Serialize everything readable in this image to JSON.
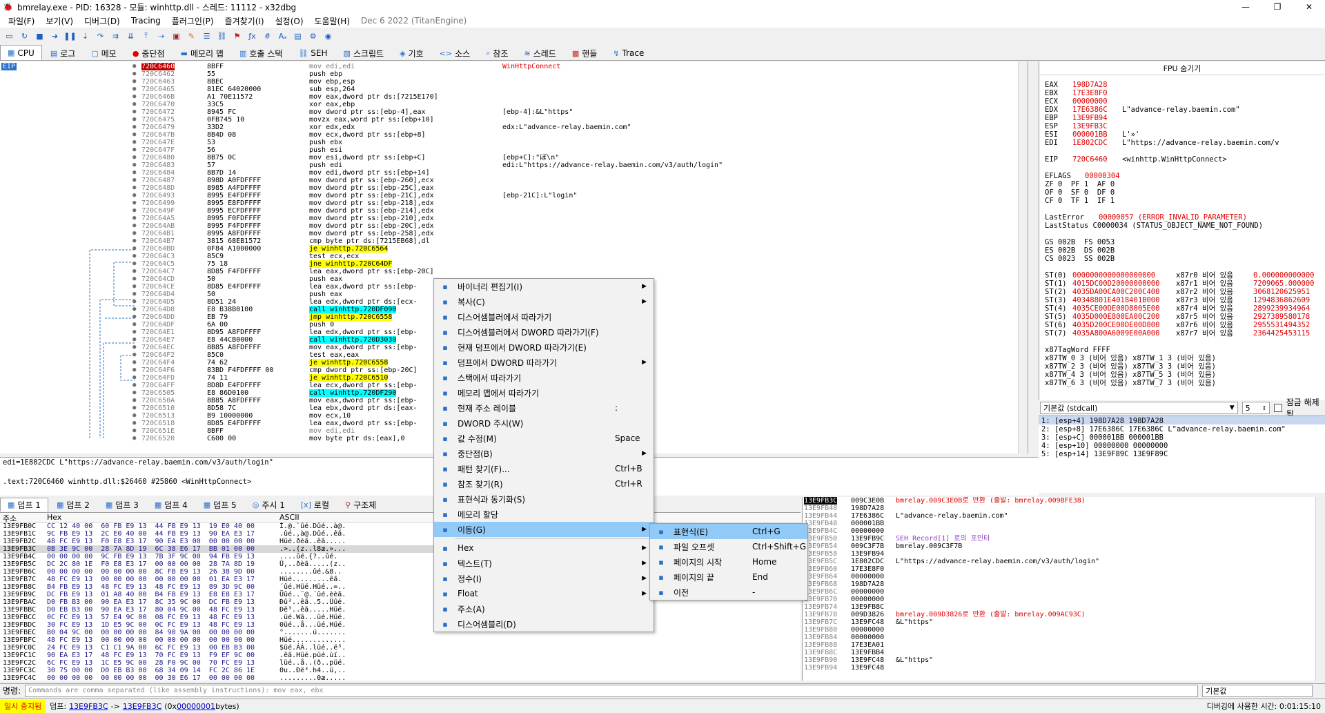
{
  "window": {
    "title": "bmrelay.exe - PID: 16328 - 모듈: winhttp.dll - 스레드: 11112 - x32dbg",
    "minimize": "—",
    "maximize": "❐",
    "close": "✕"
  },
  "menubar": [
    "파일(F)",
    "보기(V)",
    "디버그(D)",
    "Tracing",
    "플러그인(P)",
    "즐겨찾기(I)",
    "설정(O)",
    "도움말(H)"
  ],
  "build_date": "Dec 6 2022 (TitanEngine)",
  "tabs": [
    {
      "label": "CPU",
      "icon": "cpu-icon"
    },
    {
      "label": "로그",
      "icon": "log-icon"
    },
    {
      "label": "메모",
      "icon": "notes-icon"
    },
    {
      "label": "중단점",
      "icon": "breakpoint-icon"
    },
    {
      "label": "메모리 맵",
      "icon": "memory-map-icon"
    },
    {
      "label": "호출 스택",
      "icon": "call-stack-icon"
    },
    {
      "label": "SEH",
      "icon": "seh-icon"
    },
    {
      "label": "스크립트",
      "icon": "script-icon"
    },
    {
      "label": "기호",
      "icon": "symbols-icon"
    },
    {
      "label": "소스",
      "icon": "source-icon"
    },
    {
      "label": "참조",
      "icon": "references-icon"
    },
    {
      "label": "스레드",
      "icon": "threads-icon"
    },
    {
      "label": "핸들",
      "icon": "handles-icon"
    },
    {
      "label": "Trace",
      "icon": "trace-icon"
    }
  ],
  "eip_label": "EIP",
  "disasm": [
    {
      "addr": "720C6460",
      "bytes": "8BFF",
      "asm": "mov edi,edi",
      "comment": "WinHttpConnect",
      "style": "sel"
    },
    {
      "addr": "720C6462",
      "bytes": "55",
      "asm": "push ebp",
      "comment": ""
    },
    {
      "addr": "720C6463",
      "bytes": "8BEC",
      "asm": "mov ebp,esp",
      "comment": ""
    },
    {
      "addr": "720C6465",
      "bytes": "81EC 64020000",
      "asm": "sub esp,264",
      "comment": ""
    },
    {
      "addr": "720C646B",
      "bytes": "A1 70E11572",
      "asm": "mov eax,dword ptr ds:[7215E170]",
      "comment": ""
    },
    {
      "addr": "720C6470",
      "bytes": "33C5",
      "asm": "xor eax,ebp",
      "comment": ""
    },
    {
      "addr": "720C6472",
      "bytes": "8945 FC",
      "asm": "mov dword ptr ss:[ebp-4],eax",
      "comment": "[ebp-4]:&L\"https\""
    },
    {
      "addr": "720C6475",
      "bytes": "0FB745 10",
      "asm": "movzx eax,word ptr ss:[ebp+10]",
      "comment": ""
    },
    {
      "addr": "720C6479",
      "bytes": "33D2",
      "asm": "xor edx,edx",
      "comment": "edx:L\"advance-relay.baemin.com\""
    },
    {
      "addr": "720C647B",
      "bytes": "8B4D 08",
      "asm": "mov ecx,dword ptr ss:[ebp+8]",
      "comment": ""
    },
    {
      "addr": "720C647E",
      "bytes": "53",
      "asm": "push ebx",
      "comment": ""
    },
    {
      "addr": "720C647F",
      "bytes": "56",
      "asm": "push esi",
      "comment": ""
    },
    {
      "addr": "720C6480",
      "bytes": "8B75 0C",
      "asm": "mov esi,dword ptr ss:[ebp+C]",
      "comment": "[ebp+C]:\"ぼ\\n\""
    },
    {
      "addr": "720C6483",
      "bytes": "57",
      "asm": "push edi",
      "comment": "edi:L\"https://advance-relay.baemin.com/v3/auth/login\""
    },
    {
      "addr": "720C6484",
      "bytes": "8B7D 14",
      "asm": "mov edi,dword ptr ss:[ebp+14]",
      "comment": ""
    },
    {
      "addr": "720C6487",
      "bytes": "898D A0FDFFFF",
      "asm": "mov dword ptr ss:[ebp-260],ecx",
      "comment": ""
    },
    {
      "addr": "720C648D",
      "bytes": "8985 A4FDFFFF",
      "asm": "mov dword ptr ss:[ebp-25C],eax",
      "comment": ""
    },
    {
      "addr": "720C6493",
      "bytes": "8995 E4FDFFFF",
      "asm": "mov dword ptr ss:[ebp-21C],edx",
      "comment": "[ebp-21C]:L\"login\""
    },
    {
      "addr": "720C6499",
      "bytes": "8995 E8FDFFFF",
      "asm": "mov dword ptr ss:[ebp-218],edx",
      "comment": ""
    },
    {
      "addr": "720C649F",
      "bytes": "8995 ECFDFFFF",
      "asm": "mov dword ptr ss:[ebp-214],edx",
      "comment": ""
    },
    {
      "addr": "720C64A5",
      "bytes": "8995 F0FDFFFF",
      "asm": "mov dword ptr ss:[ebp-210],edx",
      "comment": ""
    },
    {
      "addr": "720C64AB",
      "bytes": "8995 F4FDFFFF",
      "asm": "mov dword ptr ss:[ebp-20C],edx",
      "comment": ""
    },
    {
      "addr": "720C64B1",
      "bytes": "8995 A8FDFFFF",
      "asm": "mov dword ptr ss:[ebp-258],edx",
      "comment": ""
    },
    {
      "addr": "720C64B7",
      "bytes": "3815 68EB1572",
      "asm": "cmp byte ptr ds:[7215EB68],dl",
      "comment": ""
    },
    {
      "addr": "720C64BD",
      "bytes": "0F84 A1000000",
      "asm": "je winhttp.720C6564",
      "comment": "",
      "style": "y"
    },
    {
      "addr": "720C64C3",
      "bytes": "85C9",
      "asm": "test ecx,ecx",
      "comment": ""
    },
    {
      "addr": "720C64C5",
      "bytes": "75 18",
      "asm": "jne winhttp.720C64DF",
      "comment": "",
      "style": "y"
    },
    {
      "addr": "720C64C7",
      "bytes": "8D85 F4FDFFFF",
      "asm": "lea eax,dword ptr ss:[ebp-20C]",
      "comment": ""
    },
    {
      "addr": "720C64CD",
      "bytes": "50",
      "asm": "push eax",
      "comment": ""
    },
    {
      "addr": "720C64CE",
      "bytes": "8D85 E4FDFFFF",
      "asm": "lea eax,dword ptr ss:[ebp-",
      "comment": ""
    },
    {
      "addr": "720C64D4",
      "bytes": "50",
      "asm": "push eax",
      "comment": ""
    },
    {
      "addr": "720C64D5",
      "bytes": "8D51 24",
      "asm": "lea edx,dword ptr ds:[ecx-",
      "comment": ""
    },
    {
      "addr": "720C64D8",
      "bytes": "E8 B38B0100",
      "asm": "call winhttp.720DF090",
      "comment": "",
      "style": "c"
    },
    {
      "addr": "720C64DD",
      "bytes": "EB 79",
      "asm": "jmp winhttp.720C6558",
      "comment": "",
      "style": "y"
    },
    {
      "addr": "720C64DF",
      "bytes": "6A 00",
      "asm": "push 0",
      "comment": ""
    },
    {
      "addr": "720C64E1",
      "bytes": "8D95 A8FDFFFF",
      "asm": "lea edx,dword ptr ss:[ebp-",
      "comment": ""
    },
    {
      "addr": "720C64E7",
      "bytes": "E8 44CB0000",
      "asm": "call winhttp.720D3030",
      "comment": "",
      "style": "c"
    },
    {
      "addr": "720C64EC",
      "bytes": "8B85 A8FDFFFF",
      "asm": "mov eax,dword ptr ss:[ebp-",
      "comment": ""
    },
    {
      "addr": "720C64F2",
      "bytes": "85C0",
      "asm": "test eax,eax",
      "comment": ""
    },
    {
      "addr": "720C64F4",
      "bytes": "74 62",
      "asm": "je winhttp.720C6558",
      "comment": "",
      "style": "y"
    },
    {
      "addr": "720C64F6",
      "bytes": "83BD F4FDFFFF 00",
      "asm": "cmp dword ptr ss:[ebp-20C]",
      "comment": ""
    },
    {
      "addr": "720C64FD",
      "bytes": "74 11",
      "asm": "je winhttp.720C6510",
      "comment": "",
      "style": "y"
    },
    {
      "addr": "720C64FF",
      "bytes": "8D8D E4FDFFFF",
      "asm": "lea ecx,dword ptr ss:[ebp-",
      "comment": ""
    },
    {
      "addr": "720C6505",
      "bytes": "E8 86D0100",
      "asm": "call winhttp.720DF290",
      "comment": "",
      "style": "c"
    },
    {
      "addr": "720C650A",
      "bytes": "8B85 A8FDFFFF",
      "asm": "mov eax,dword ptr ss:[ebp-",
      "comment": ""
    },
    {
      "addr": "720C6510",
      "bytes": "8D58 7C",
      "asm": "lea ebx,dword ptr ds:[eax-",
      "comment": ""
    },
    {
      "addr": "720C6513",
      "bytes": "B9 10000000",
      "asm": "mov ecx,10",
      "comment": ""
    },
    {
      "addr": "720C6518",
      "bytes": "8D85 E4FDFFFF",
      "asm": "lea eax,dword ptr ss:[ebp-",
      "comment": ""
    },
    {
      "addr": "720C651E",
      "bytes": "8BFF",
      "asm": "mov edi,edi",
      "comment": "",
      "style": "g"
    },
    {
      "addr": "720C6520",
      "bytes": "C600 00",
      "asm": "mov byte ptr ds:[eax],0",
      "comment": ""
    }
  ],
  "info_lines": [
    "edi=1E802CDC L\"https://advance-relay.baemin.com/v3/auth/login\"",
    "",
    ".text:720C6460 winhttp.dll:$26460 #25860 <WinHttpConnect>"
  ],
  "fpu": {
    "header": "FPU 숨기기",
    "regs": [
      {
        "name": "EAX",
        "val": "198D7A28",
        "note": ""
      },
      {
        "name": "EBX",
        "val": "17E3E8F0",
        "note": ""
      },
      {
        "name": "ECX",
        "val": "00000000",
        "note": ""
      },
      {
        "name": "EDX",
        "val": "17E6386C",
        "note": "L\"advance-relay.baemin.com\""
      },
      {
        "name": "EBP",
        "val": "13E9FB94",
        "note": ""
      },
      {
        "name": "ESP",
        "val": "13E9FB3C",
        "note": ""
      },
      {
        "name": "ESI",
        "val": "000001BB",
        "note": "L'»'"
      },
      {
        "name": "EDI",
        "val": "1E802CDC",
        "note": "L\"https://advance-relay.baemin.com/v"
      }
    ],
    "eip": {
      "name": "EIP",
      "val": "720C6460",
      "note": "<winhttp.WinHttpConnect>"
    },
    "eflags": {
      "name": "EFLAGS",
      "val": "00000304"
    },
    "flags": [
      "ZF 0  PF 1  AF 0",
      "OF 0  SF 0  DF 0",
      "CF 0  TF 1  IF 1"
    ],
    "last_error": {
      "label": "LastError",
      "val": "00000057 (ERROR_INVALID_PARAMETER)"
    },
    "last_status": "LastStatus C0000034 (STATUS_OBJECT_NAME_NOT_FOUND)",
    "segs": [
      "GS 002B  FS 0053",
      "ES 002B  DS 002B",
      "CS 0023  SS 002B"
    ],
    "st": [
      {
        "name": "ST(0)",
        "val": "0000000000000000000",
        "tag": "x87r0 비어 있음",
        "num": "0.000000000000"
      },
      {
        "name": "ST(1)",
        "val": "4015DC00D20000000000",
        "tag": "x87r1 비어 있음",
        "num": "7209065.000000"
      },
      {
        "name": "ST(2)",
        "val": "4035DA00CA00C200C400",
        "tag": "x87r2 비어 있음",
        "num": "3068120625951"
      },
      {
        "name": "ST(3)",
        "val": "40348801E4018401B000",
        "tag": "x87r3 비어 있음",
        "num": "1294836862609"
      },
      {
        "name": "ST(4)",
        "val": "4035CE00DE00D8005E00",
        "tag": "x87r4 비어 있음",
        "num": "2899239934964"
      },
      {
        "name": "ST(5)",
        "val": "4035D000E800EA00C200",
        "tag": "x87r5 비어 있음",
        "num": "2927389580178"
      },
      {
        "name": "ST(6)",
        "val": "4035D200CE00DE00D800",
        "tag": "x87r6 비어 있음",
        "num": "2955531494352"
      },
      {
        "name": "ST(7)",
        "val": "4035A800A6009E00A000",
        "tag": "x87r7 비어 있음",
        "num": "2364425453115"
      }
    ],
    "tagword": "x87TagWord FFFF",
    "tags": [
      "x87TW_0 3 (비어 있음) x87TW_1 3 (비어 있음)",
      "x87TW_2 3 (비어 있음) x87TW_3 3 (비어 있음)",
      "x87TW_4 3 (비어 있음) x87TW_5 3 (비어 있음)",
      "x87TW_6 3 (비어 있음) x87TW_7 3 (비어 있음)"
    ]
  },
  "callconv": {
    "value": "기본값 (stdcall)",
    "count": "5",
    "lock_label": "잠금 해제됨"
  },
  "stack_args": [
    "1: [esp+4] 198D7A28 198D7A28",
    "2: [esp+8] 17E6386C 17E6386C L\"advance-relay.baemin.com\"",
    "3: [esp+C] 000001BB 000001BB",
    "4: [esp+10] 00000000 00000000",
    "5: [esp+14] 13E9F89C 13E9F89C"
  ],
  "dump_tabs": [
    "덤프 1",
    "덤프 2",
    "덤프 3",
    "덤프 4",
    "덤프 5",
    "주시 1",
    "로컬",
    "구조체"
  ],
  "dump_headers": {
    "addr": "주소",
    "hex": "Hex",
    "ascii": "ASCII"
  },
  "dump": [
    {
      "a": "13E9FB0C",
      "h": "CC 12 40 00  60 FB E9 13  44 FB E9 13  19 E0 40 00",
      "s": "Ì.@.`ûé.Dûé..à@."
    },
    {
      "a": "13E9FB1C",
      "h": "9C FB E9 13  2C E0 40 00  44 FB E9 13  90 EA E3 17",
      "s": ".ûé.,à@.Dûé..êã."
    },
    {
      "a": "13E9FB2C",
      "h": "48 FC E9 13  F0 E8 E3 17  90 EA E3 00  00 00 00 00",
      "s": "Hüé.ðèã..êã....."
    },
    {
      "a": "13E9FB3C",
      "h": "0B 3E 9C 00  28 7A 8D 19  6C 38 E6 17  BB 01 00 00",
      "s": ".>..(z..l8æ.»..."
    },
    {
      "a": "13E9FB4C",
      "h": "00 00 00 00  9C FB E9 13  7B 3F 9C 00  94 FB E9 13",
      "s": "....ûé.{?..ûé."
    },
    {
      "a": "13E9FB5C",
      "h": "DC 2C 80 1E  F0 E8 E3 17  00 00 00 00  28 7A 8D 19",
      "s": "Ü,..ðèã.....(z.."
    },
    {
      "a": "13E9FB6C",
      "h": "00 00 00 00  00 00 00 00  8C FB E9 13  26 38 9D 00",
      "s": "........ûé.&8.."
    },
    {
      "a": "13E9FB7C",
      "h": "48 FC E9 13  00 00 00 00  00 00 00 00  01 EA E3 17",
      "s": "Hüé.........êã."
    },
    {
      "a": "13E9FB8C",
      "h": "B4 FB E9 13  48 FC E9 13  48 FC E9 13  89 3D 9C 00",
      "s": "´ûé.Hüé.Hüé..=.."
    },
    {
      "a": "13E9FB9C",
      "h": "DC FB E9 13  01 A8 40 00  B4 FB E9 13  E8 E8 E3 17",
      "s": "Üûé..¨@.´ûé.èèã."
    },
    {
      "a": "13E9FBAC",
      "h": "D0 FB B3 00  90 EA E3 17  8C 35 9C 00  DC FB E9 13",
      "s": "Ðû³..êã..5..Üûé."
    },
    {
      "a": "13E9FBBC",
      "h": "D0 EB B3 00  90 EA E3 17  80 04 9C 00  48 FC E9 13",
      "s": "Ðë³..êã.....Hüé."
    },
    {
      "a": "13E9FBCC",
      "h": "0C FC E9 13  57 E4 9C 00  08 FC E9 13  48 FC E9 13",
      "s": ".üé.Wä...üé.Hüé."
    },
    {
      "a": "13E9FBDC",
      "h": "30 FC E9 13  1D E5 9C 00  0C FC E9 13  48 FC E9 13",
      "s": "0üé..å...üé.Hüé."
    },
    {
      "a": "13E9FBEC",
      "h": "B0 04 9C 00  00 00 00 00  84 90 9A 00  00 00 00 00",
      "s": "°.......ú......."
    },
    {
      "a": "13E9FBFC",
      "h": "48 FC E9 13  00 00 00 00  00 00 00 00  00 00 00 00",
      "s": "Hüé............."
    },
    {
      "a": "13E9FC0C",
      "h": "24 FC E9 13  C1 C1 9A 00  6C FC E9 13  00 EB B3 00",
      "s": "$üé.ÁÁ..lüé..ë³."
    },
    {
      "a": "13E9FC1C",
      "h": "90 EA E3 17  48 FC E9 13  70 FC E9 13  F9 EF 9C 00",
      "s": ".êã.Hüé.püé.ùï.."
    },
    {
      "a": "13E9FC2C",
      "h": "6C FC E9 13  1C E5 9C 00  28 F0 9C 00  70 FC E9 13",
      "s": "lüé..å..(ð..püé."
    },
    {
      "a": "13E9FC3C",
      "h": "30 75 00 00  D0 EB B3 00  68 34 09 14  FC 2C 86 1E",
      "s": "0u..Ðë³.h4..ü,.."
    },
    {
      "a": "13E9FC4C",
      "h": "00 00 00 00  00 00 00 00  00 30 E6 17  00 00 00 00",
      "s": ".........0æ....."
    }
  ],
  "stack": [
    {
      "a": "13E9FB3C",
      "v": "009C3E0B",
      "c": "bmrelay.009C3E0B로 반환 (출발: bmrelay.009BFE38)",
      "cls": "red",
      "top": true
    },
    {
      "a": "13E9FB40",
      "v": "198D7A28",
      "c": ""
    },
    {
      "a": "13E9FB44",
      "v": "17E6386C",
      "c": "L\"advance-relay.baemin.com\""
    },
    {
      "a": "13E9FB48",
      "v": "000001BB",
      "c": ""
    },
    {
      "a": "13E9FB4C",
      "v": "00000000",
      "c": ""
    },
    {
      "a": "13E9FB50",
      "v": "13E9FB9C",
      "c": "SEH_Record[1] 로의 포인터",
      "cls": "purple"
    },
    {
      "a": "13E9FB54",
      "v": "009C3F7B",
      "c": "bmrelay.009C3F7B"
    },
    {
      "a": "13E9FB58",
      "v": "13E9FB94",
      "c": ""
    },
    {
      "a": "13E9FB5C",
      "v": "1E802CDC",
      "c": "L\"https://advance-relay.baemin.com/v3/auth/login\""
    },
    {
      "a": "13E9FB60",
      "v": "17E3E8F0",
      "c": ""
    },
    {
      "a": "13E9FB64",
      "v": "00000000",
      "c": ""
    },
    {
      "a": "13E9FB68",
      "v": "198D7A28",
      "c": ""
    },
    {
      "a": "13E9FB6C",
      "v": "00000000",
      "c": ""
    },
    {
      "a": "13E9FB70",
      "v": "00000000",
      "c": ""
    },
    {
      "a": "13E9FB74",
      "v": "13E9FB8C",
      "c": ""
    },
    {
      "a": "13E9FB78",
      "v": "009D3826",
      "c": "bmrelay.009D3826로 반환 (출발: bmrelay.009AC93C)",
      "cls": "red"
    },
    {
      "a": "13E9FB7C",
      "v": "13E9FC48",
      "c": "&L\"https\""
    },
    {
      "a": "13E9FB80",
      "v": "00000000",
      "c": ""
    },
    {
      "a": "13E9FB84",
      "v": "00000000",
      "c": ""
    },
    {
      "a": "13E9FB88",
      "v": "17E3EA01",
      "c": ""
    },
    {
      "a": "13E9FB8C",
      "v": "13E9FBB4",
      "c": ""
    },
    {
      "a": "13E9FB90",
      "v": "13E9FC48",
      "c": "&L\"https\""
    },
    {
      "a": "13E9FB94",
      "v": "13E9FC48",
      "c": ""
    }
  ],
  "command": {
    "label": "명령:",
    "placeholder": "Commands are comma separated (like assembly instructions): mov eax, ebx",
    "mode": "기본값"
  },
  "status": {
    "paused": "일시 중지됨",
    "dump_label": "덤프:",
    "from": "13E9FB3C",
    "arrow": "->",
    "to": "13E9FB3C",
    "bytes_pre": "(0x",
    "bytes_val": "00000001",
    "bytes_post": " bytes)",
    "time": "디버깅에 사용한 시간: 0:01:15:10"
  },
  "context_menu": [
    {
      "label": "바이너리 편집기(I)",
      "icon": "binary-icon",
      "arrow": true
    },
    {
      "label": "복사(C)",
      "icon": "copy-icon",
      "arrow": true
    },
    {
      "label": "디스어셈블러에서 따라가기",
      "icon": "follow-disasm-icon"
    },
    {
      "label": "디스어셈블러에서 DWORD 따라가기(F)",
      "icon": "follow-disasm-dword-icon"
    },
    {
      "label": "현재 덤프에서 DWORD 따라가기(E)",
      "icon": "follow-dump-dword-icon"
    },
    {
      "label": "덤프에서 DWORD 따라가기",
      "icon": "dump-dword-icon",
      "arrow": true
    },
    {
      "label": "스택에서 따라가기",
      "icon": "follow-stack-icon"
    },
    {
      "label": "메모리 맵에서 따라가기",
      "icon": "follow-memmap-icon"
    },
    {
      "label": "현재 주소 레이블",
      "icon": "label-icon",
      "shortcut": ":"
    },
    {
      "label": "DWORD 주시(W)",
      "icon": "watch-icon"
    },
    {
      "label": "값 수정(M)",
      "icon": "edit-icon",
      "shortcut": "Space"
    },
    {
      "label": "중단점(B)",
      "icon": "breakpoint-dot-icon",
      "arrow": true
    },
    {
      "label": "패턴 찾기(F)...",
      "icon": "pattern-icon",
      "shortcut": "Ctrl+B"
    },
    {
      "label": "참조 찾기(R)",
      "icon": "find-refs-icon",
      "shortcut": "Ctrl+R"
    },
    {
      "label": "표현식과 동기화(S)",
      "icon": "sync-icon"
    },
    {
      "label": "메모리 할당",
      "icon": "alloc-icon"
    },
    {
      "label": "이동(G)",
      "icon": "goto-icon",
      "arrow": true,
      "highlight": true
    },
    {
      "sep": true
    },
    {
      "label": "Hex",
      "icon": "hex-icon",
      "arrow": true
    },
    {
      "label": "텍스트(T)",
      "icon": "text-icon",
      "arrow": true
    },
    {
      "label": "정수(I)",
      "icon": "integer-icon",
      "arrow": true
    },
    {
      "label": "Float",
      "icon": "float-icon",
      "arrow": true
    },
    {
      "label": "주소(A)",
      "icon": "address-icon"
    },
    {
      "label": "디스어셈블리(D)",
      "icon": "disasm-view-icon"
    }
  ],
  "submenu": [
    {
      "label": "표현식(E)",
      "icon": "expression-icon",
      "shortcut": "Ctrl+G",
      "highlight": true
    },
    {
      "label": "파일 오프셋",
      "icon": "file-offset-icon",
      "shortcut": "Ctrl+Shift+G"
    },
    {
      "label": "페이지의 시작",
      "icon": "page-start-icon",
      "shortcut": "Home"
    },
    {
      "label": "페이지의 끝",
      "icon": "page-end-icon",
      "shortcut": "End"
    },
    {
      "label": "이전",
      "icon": "previous-icon",
      "shortcut": "-"
    }
  ]
}
